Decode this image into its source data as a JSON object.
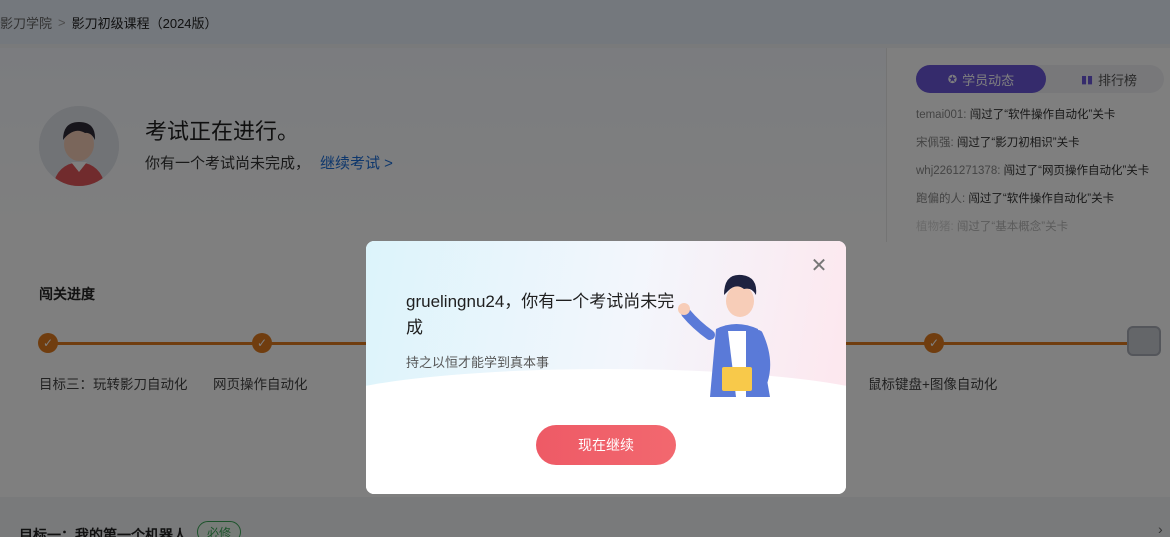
{
  "breadcrumb": {
    "root": "影刀学院",
    "separator": ">",
    "current": "影刀初级课程（2024版）"
  },
  "hero": {
    "title": "考试正在进行。",
    "subtitle": "你有一个考试尚未完成，",
    "link": "继续考试 >"
  },
  "side": {
    "tab_active": "学员动态",
    "tab_inactive": "排行榜",
    "tab_active_icon": "star-badge-icon",
    "tab_inactive_icon": "bar-chart-icon",
    "feed": [
      {
        "user": "temai001:",
        "text": "闯过了“软件操作自动化”关卡"
      },
      {
        "user": "宋佩强:",
        "text": "闯过了“影刀初相识”关卡"
      },
      {
        "user": "whj2261271378:",
        "text": "闯过了“网页操作自动化”关卡"
      },
      {
        "user": "跑偏的人:",
        "text": "闯过了“软件操作自动化”关卡"
      },
      {
        "user": "植物猪:",
        "text": "闯过了“基本概念”关卡"
      }
    ]
  },
  "progress": {
    "title": "闯关进度",
    "nodes": [
      "目标三：玩转影刀自动化",
      "网页操作自动化",
      "鼠标键盘+图像自动化"
    ]
  },
  "bottom": {
    "title": "目标一：我的第一个机器人",
    "badge": "必修"
  },
  "modal": {
    "title": "gruelingnu24，你有一个考试尚未完成",
    "subtitle": "持之以恒才能学到真本事",
    "button": "现在继续",
    "close_icon": "close-icon"
  },
  "colors": {
    "accent_purple": "#6a57d9",
    "progress_orange": "#e07b1f",
    "button_red": "#ee5a66",
    "link_blue": "#1d6fd8",
    "required_green": "#3aa757"
  }
}
